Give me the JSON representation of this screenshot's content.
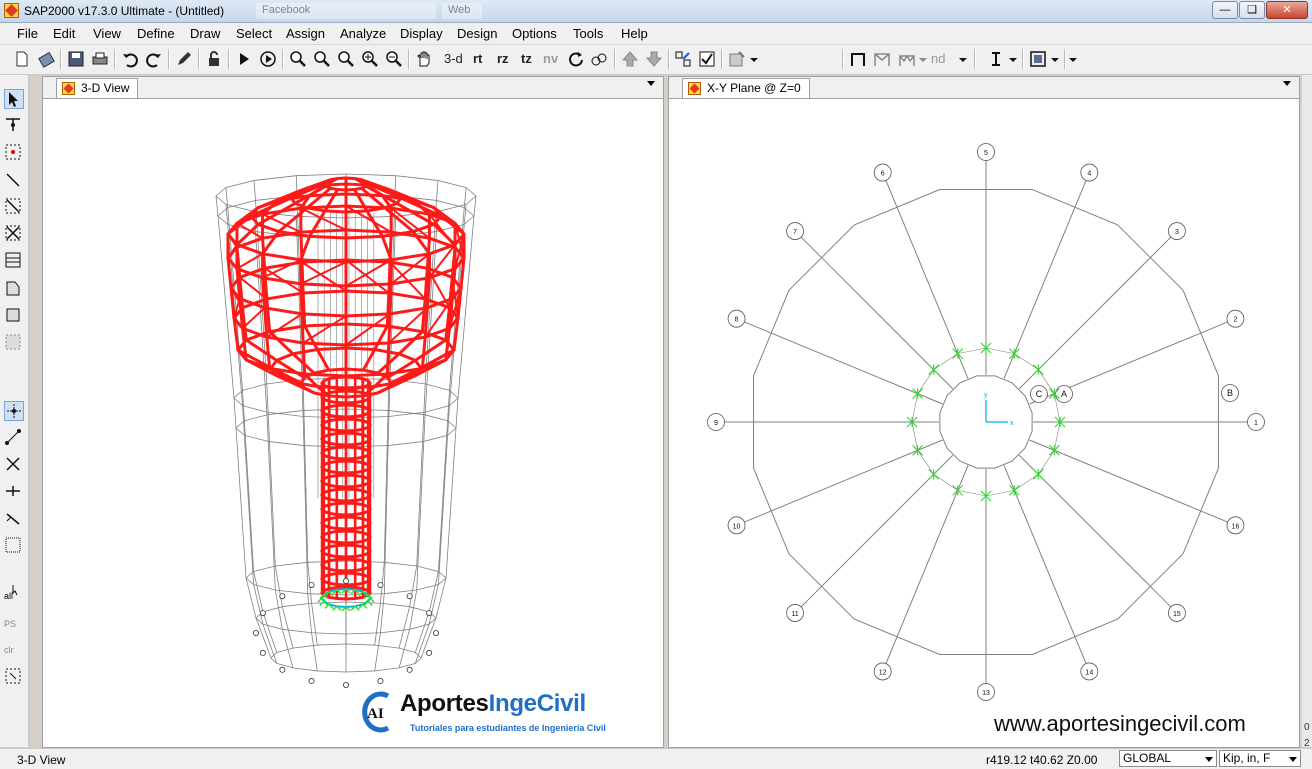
{
  "window": {
    "title": "SAP2000 v17.3.0 Ultimate  - (Untitled)",
    "background_tabs": [
      "Facebook",
      "Web"
    ],
    "controls": [
      "minimize",
      "maximize",
      "close"
    ]
  },
  "menu": [
    "File",
    "Edit",
    "View",
    "Define",
    "Draw",
    "Select",
    "Assign",
    "Analyze",
    "Display",
    "Design",
    "Options",
    "Tools",
    "Help"
  ],
  "toolbar": {
    "view_3d": "3-d",
    "rt": "rt",
    "rz": "rz",
    "tz": "tz",
    "nv": "nv",
    "nd": "nd"
  },
  "left_toolbar": {
    "all": "all",
    "ps": "PS",
    "clr": "clr"
  },
  "panes": {
    "left": {
      "tab": "3-D View"
    },
    "right": {
      "tab": "X-Y Plane @ Z=0"
    }
  },
  "grid_labels": [
    "1",
    "2",
    "3",
    "4",
    "5",
    "6",
    "7",
    "8",
    "9",
    "10",
    "11",
    "12",
    "13",
    "14",
    "15",
    "16"
  ],
  "plan_labels": {
    "A": "A",
    "B": "B",
    "C": "C",
    "y": "y",
    "x": "x"
  },
  "watermark": {
    "mark": "AI",
    "brand_part1": "Aportes",
    "brand_part2": "IngeCivil",
    "tagline": "Tutoriales para estudiantes de Ingeniería Civil",
    "website": "www.aportesingecivil.com"
  },
  "status": {
    "view_name": "3-D View",
    "coords": "r419.12  t40.62  Z0.00",
    "coord_system": "GLOBAL",
    "units": "Kip, in, F"
  },
  "colors": {
    "frame_highlight": "#ff1a1a",
    "grid_lines": "#808080",
    "restraints": "#33dd33",
    "axes": "#00b0e0"
  }
}
